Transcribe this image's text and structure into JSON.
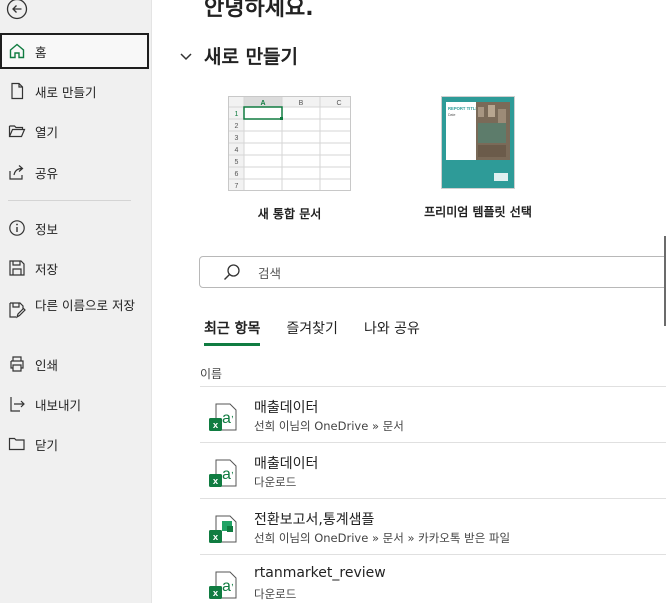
{
  "sidebar": {
    "items": [
      {
        "label": "홈",
        "icon": "home-icon"
      },
      {
        "label": "새로 만들기",
        "icon": "new-document-icon"
      },
      {
        "label": "열기",
        "icon": "open-folder-icon"
      },
      {
        "label": "공유",
        "icon": "share-icon"
      },
      {
        "label": "정보",
        "icon": "info-icon"
      },
      {
        "label": "저장",
        "icon": "save-icon"
      },
      {
        "label": "다른 이름으로 저장",
        "icon": "save-as-icon"
      },
      {
        "label": "인쇄",
        "icon": "print-icon"
      },
      {
        "label": "내보내기",
        "icon": "export-icon"
      },
      {
        "label": "닫기",
        "icon": "close-folder-icon"
      }
    ]
  },
  "main": {
    "greeting": "안녕하세요.",
    "new_section_title": "새로 만들기",
    "templates": [
      {
        "label": "새 통합 문서"
      },
      {
        "label": "프리미엄 템플릿 선택"
      }
    ],
    "sheet_preview": {
      "columns": [
        "A",
        "B",
        "C"
      ],
      "rows": [
        "1",
        "2",
        "3",
        "4",
        "5",
        "6",
        "7"
      ]
    },
    "brochure_preview": {
      "heading": "REPORT TITLE",
      "sub": "Date"
    },
    "search": {
      "placeholder": "검색"
    },
    "tabs": [
      {
        "label": "최근 항목",
        "active": true
      },
      {
        "label": "즐겨찾기",
        "active": false
      },
      {
        "label": "나와 공유",
        "active": false
      }
    ],
    "column_header": "이름",
    "files": [
      {
        "name": "매출데이터",
        "location": "선희 이님의 OneDrive » 문서",
        "icon": "excel-file-icon"
      },
      {
        "name": "매출데이터",
        "location": "다운로드",
        "icon": "excel-file-icon"
      },
      {
        "name": "전환보고서,통계샘플",
        "location": "선희 이님의 OneDrive » 문서 » 카카오톡 받은 파일",
        "icon": "excel-template-file-icon"
      },
      {
        "name": "rtanmarket_review",
        "location": "다운로드",
        "icon": "excel-file-icon"
      }
    ]
  },
  "colors": {
    "accent_green": "#107c41",
    "sidebar_bg": "#f0f0f0"
  }
}
